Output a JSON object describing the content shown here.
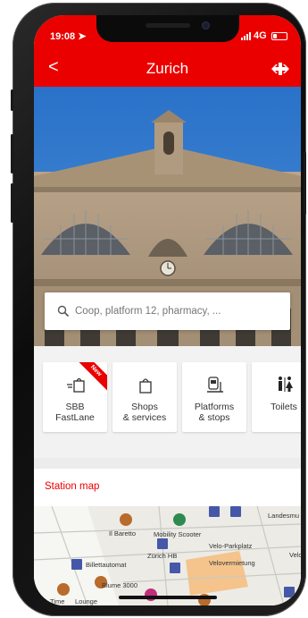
{
  "status_bar": {
    "time": "19:08",
    "network": "4G"
  },
  "header": {
    "title": "Zurich",
    "back_label": "<"
  },
  "search": {
    "placeholder": "Coop, platform 12, pharmacy, ..."
  },
  "tiles": [
    {
      "label": "SBB\nFastLane",
      "badge": "New",
      "icon": "shopping-bag-hand-icon"
    },
    {
      "label": "Shops\n& services",
      "icon": "shopping-bag-icon"
    },
    {
      "label": "Platforms\n& stops",
      "icon": "train-platform-icon"
    },
    {
      "label": "Toilets",
      "icon": "toilets-icon"
    }
  ],
  "station_map": {
    "heading": "Station map",
    "labels": [
      "Il Baretto",
      "Mobility Scooter",
      "Zürich HB",
      "Billettautomat",
      "Velo-Parkplatz",
      "Velovermietung",
      "Blume 3000",
      "Time",
      "Lounge",
      "Landesmu",
      "Velo"
    ]
  },
  "colors": {
    "brand_red": "#eb0000",
    "sky": "#2f7bd0"
  }
}
